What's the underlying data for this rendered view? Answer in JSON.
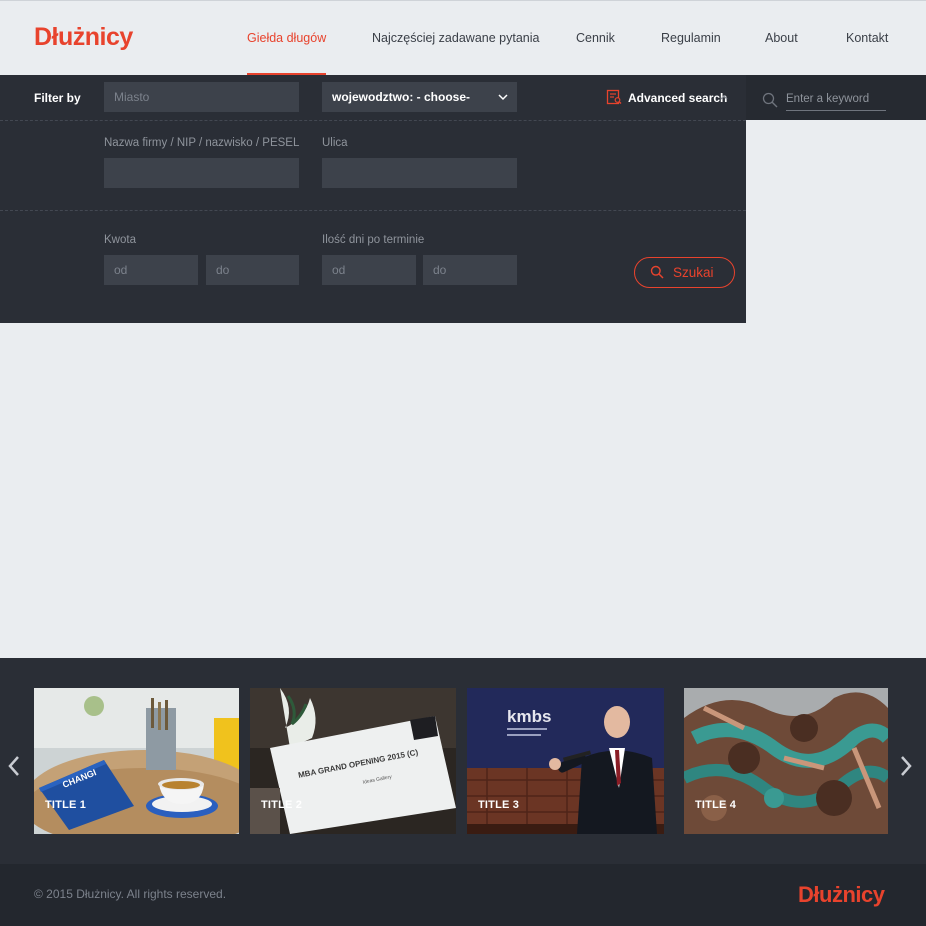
{
  "brand": {
    "logo": "Dłużnicy",
    "accent": "#e8432d"
  },
  "nav": {
    "items": [
      {
        "label": "Giełda długów",
        "active": true
      },
      {
        "label": "Najczęściej zadawane pytania"
      },
      {
        "label": "Cennik"
      },
      {
        "label": "Regulamin"
      },
      {
        "label": "About"
      },
      {
        "label": "Kontakt"
      }
    ]
  },
  "filter": {
    "label": "Filter by",
    "city_placeholder": "Miasto",
    "region_value": "wojewodztwo: - choose-",
    "advanced_label": "Advanced search",
    "company_label": "Nazwa firmy / NIP / nazwisko / PESEL",
    "street_label": "Ulica",
    "amount_label": "Kwota",
    "days_label": "Ilość dni po terminie",
    "from_placeholder": "od",
    "to_placeholder": "do",
    "search_button": "Szukai"
  },
  "keyword": {
    "placeholder": "Enter a keyword"
  },
  "carousel": {
    "slides": [
      {
        "title": "TITLE 1",
        "icon": "notebook-coffee-image"
      },
      {
        "title": "TITLE 2",
        "icon": "mba-opening-sign-image"
      },
      {
        "title": "TITLE 3",
        "icon": "speaker-conference-image"
      },
      {
        "title": "TITLE 4",
        "icon": "sculpture-image"
      }
    ],
    "photo_texts": {
      "notebook": "CHANGI",
      "sign": "MBA GRAND OPENING 2015 (C)",
      "sign_sub": "Ideas Gallery",
      "banner": "kmbs"
    }
  },
  "footer": {
    "copyright": "© 2015 Dłużnicy. All rights reserved.",
    "logo": "Dłużnicy"
  }
}
